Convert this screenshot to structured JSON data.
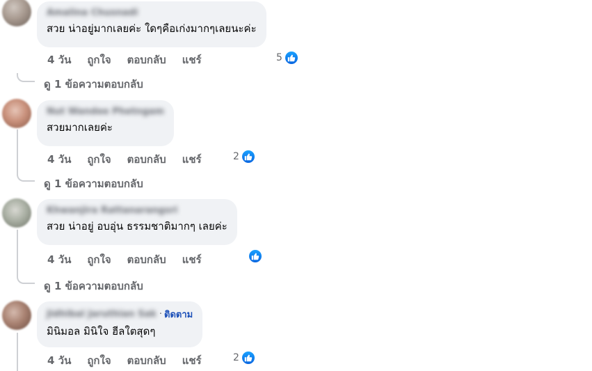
{
  "comments": [
    {
      "author": "Amalina Chusnadi",
      "text": "สวย น่าอยู่มากเลยค่ะ ใดๆคือเก่งมากๆเลยนะค่ะ",
      "time": "4 วัน",
      "like": "ถูกใจ",
      "reply": "ตอบกลับ",
      "share": "แชร์",
      "reaction_count": "5",
      "view_replies": "ดู 1 ข้อความตอบกลับ"
    },
    {
      "author": "Nut Wandee Phetngam",
      "text": "สวยมากเลยค่ะ",
      "time": "4 วัน",
      "like": "ถูกใจ",
      "reply": "ตอบกลับ",
      "share": "แชร์",
      "reaction_count": "2",
      "view_replies": "ดู 1 ข้อความตอบกลับ"
    },
    {
      "author": "Khwanjira Rattanarangsri",
      "text": "สวย น่าอยู่ อบอุ่น ธรรมชาติมากๆ เลยค่ะ",
      "time": "4 วัน",
      "like": "ถูกใจ",
      "reply": "ตอบกลับ",
      "share": "แชร์",
      "reaction_count": "",
      "view_replies": "ดู 1 ข้อความตอบกลับ"
    },
    {
      "author": "Jidhibal Jaruthian Sak",
      "follow": "ติดตาม",
      "text": "มินิมอล มินิใจ ฮีลใตสุดๆ",
      "time": "4 วัน",
      "like": "ถูกใจ",
      "reply": "ตอบกลับ",
      "share": "แชร์",
      "reaction_count": "2"
    }
  ],
  "icons": {
    "reaction": "like-thumb-icon",
    "accent": "#1877f2"
  }
}
